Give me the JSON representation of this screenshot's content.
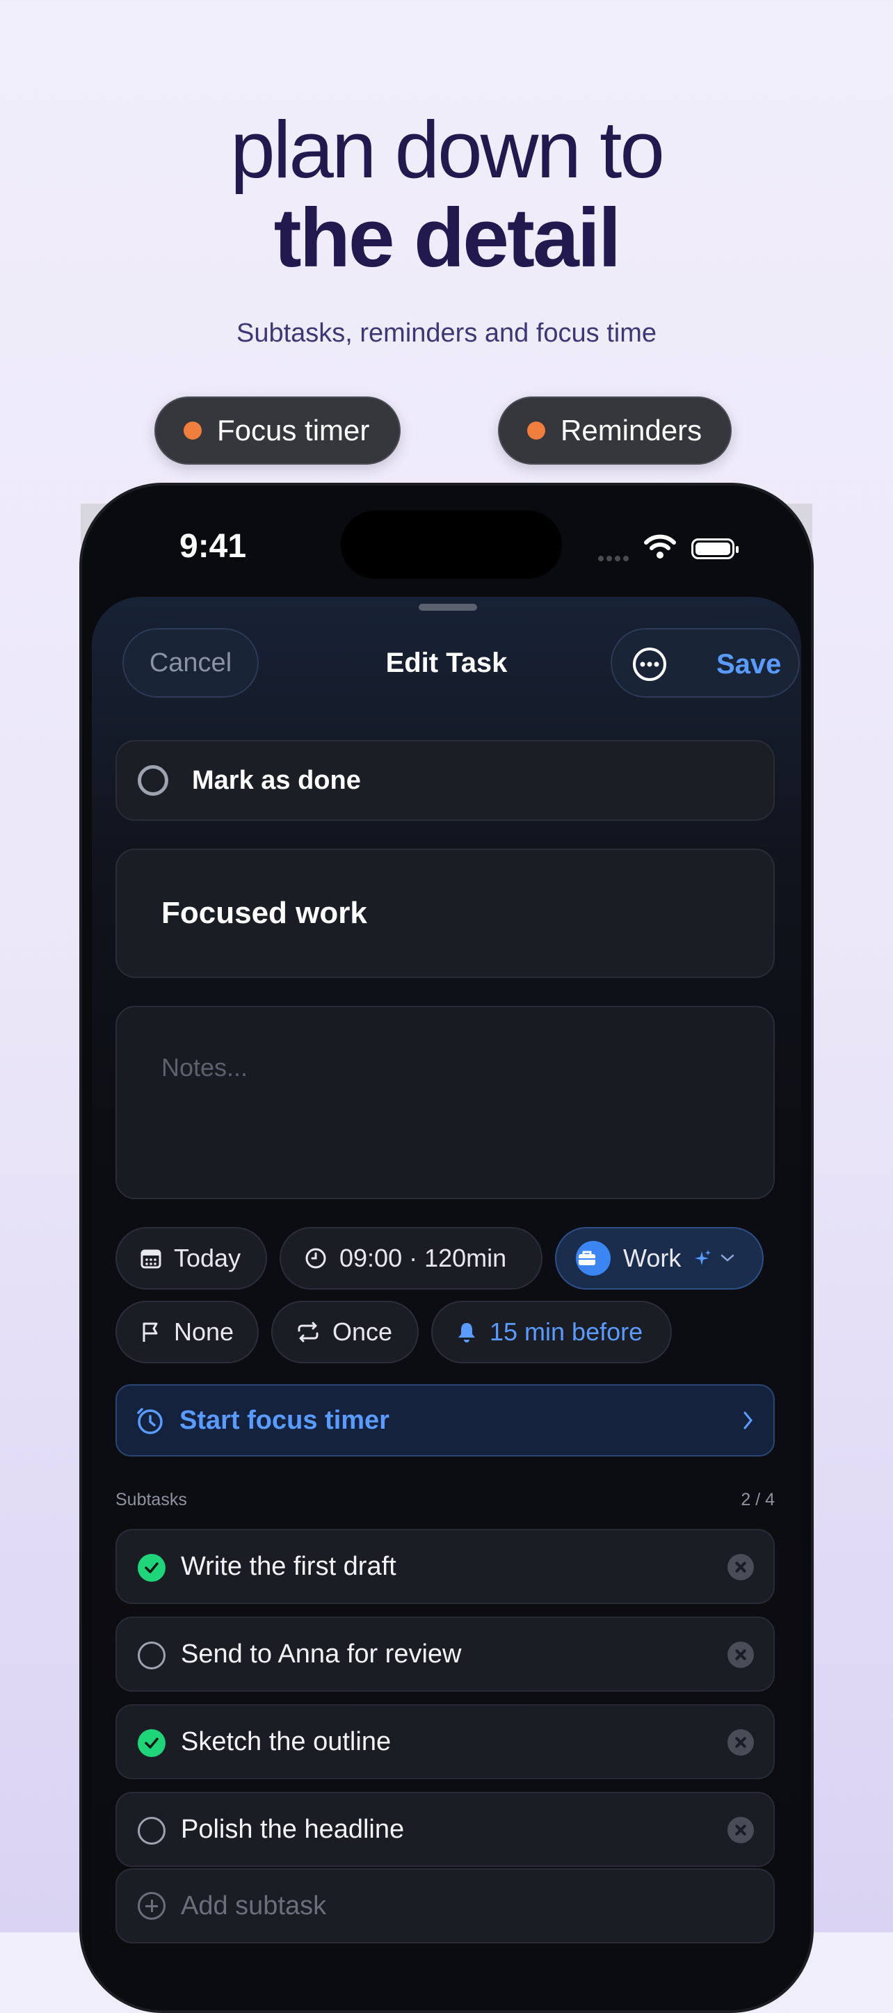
{
  "hero": {
    "line1": "plan down to",
    "line2": "the detail",
    "tagline": "Subtasks, reminders and focus time"
  },
  "pills": [
    {
      "label": "Focus timer"
    },
    {
      "label": "Reminders"
    }
  ],
  "status_bar": {
    "time": "9:41"
  },
  "nav": {
    "cancel": "Cancel",
    "title": "Edit Task",
    "save": "Save"
  },
  "task": {
    "done_label": "Mark as done",
    "title": "Focused work",
    "notes_placeholder": "Notes..."
  },
  "chips": {
    "date": "Today",
    "time": "09:00 · 120min",
    "list": "Work",
    "priority": "None",
    "repeat": "Once",
    "reminder": "15 min before"
  },
  "focus": {
    "label": "Start focus timer"
  },
  "subtasks": {
    "header": "Subtasks",
    "count": "2 / 4",
    "items": [
      {
        "text": "Write the first draft",
        "done": true
      },
      {
        "text": "Send to Anna for review",
        "done": false
      },
      {
        "text": "Sketch the outline",
        "done": true
      },
      {
        "text": "Polish the headline",
        "done": false
      }
    ],
    "add_placeholder": "Add subtask"
  },
  "colors": {
    "accent": "#5a9bff",
    "pill_dot": "#f07e3c",
    "done_green": "#1ed57a",
    "headline": "#221a4f"
  }
}
